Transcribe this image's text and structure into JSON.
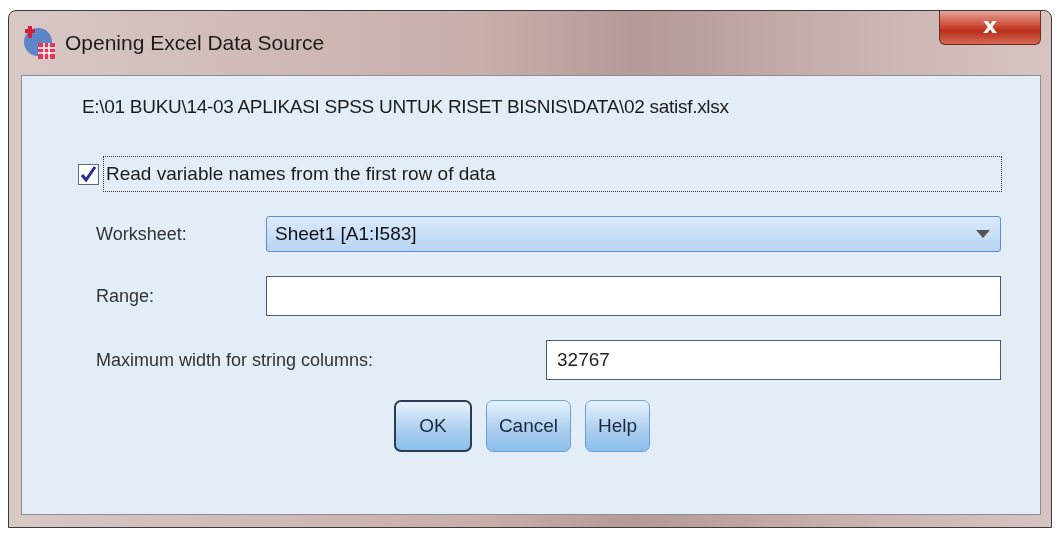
{
  "window": {
    "title": "Opening Excel Data Source",
    "close": "x"
  },
  "file_path": "E:\\01 BUKU\\14-03 APLIKASI SPSS UNTUK RISET BISNIS\\DATA\\02 satisf.xlsx",
  "read_names": {
    "label": "Read variable names from the first row of data",
    "checked": true
  },
  "worksheet": {
    "label": "Worksheet:",
    "value": "Sheet1 [A1:I583]"
  },
  "range": {
    "label": "Range:"
  },
  "max_width": {
    "label": "Maximum width for string columns:",
    "value": "32767"
  },
  "buttons": [
    {
      "label": "OK",
      "selected": true
    },
    {
      "label": "Cancel",
      "selected": false
    },
    {
      "label": "Help",
      "selected": false
    }
  ]
}
